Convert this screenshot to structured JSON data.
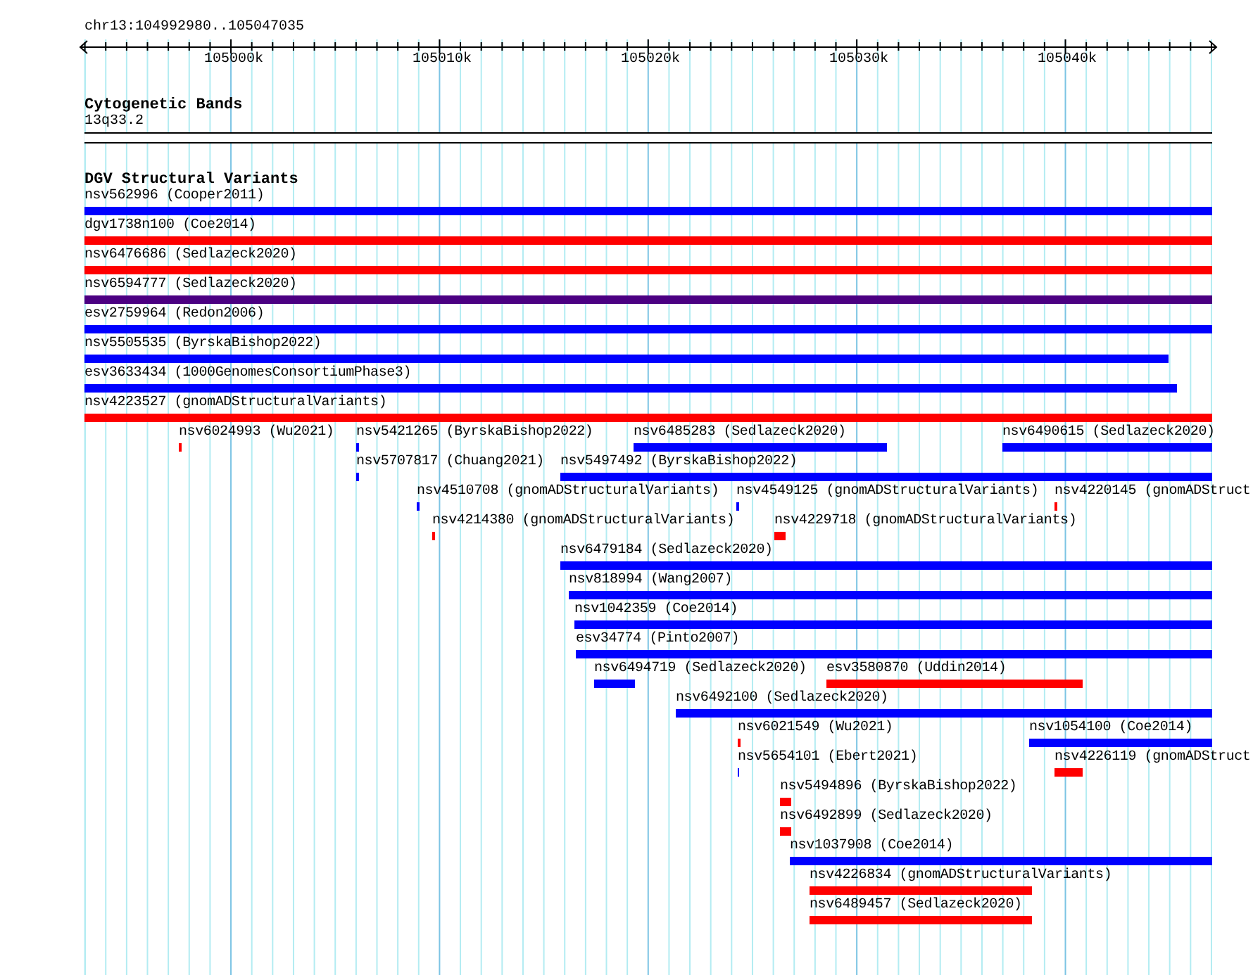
{
  "ruler": {
    "location": "chr13:104992980..105047035",
    "ticks": [
      {
        "label": "105000k"
      },
      {
        "label": "105010k"
      },
      {
        "label": "105020k"
      },
      {
        "label": "105030k"
      },
      {
        "label": "105040k"
      }
    ]
  },
  "tracks": [
    {
      "title": "Cytogenetic Bands",
      "kind": "bands",
      "bands": [
        {
          "label": "13q33.2"
        }
      ]
    },
    {
      "title": "DGV Structural Variants",
      "kind": "variants",
      "rows": [
        {
          "features": [
            {
              "label": "nsv562996 (Cooper2011)",
              "color": "#0000ff"
            }
          ]
        },
        {
          "features": [
            {
              "label": "dgv1738n100 (Coe2014)",
              "color": "#ff0000"
            }
          ]
        },
        {
          "features": [
            {
              "label": "nsv6476686 (Sedlazeck2020)",
              "color": "#ff0000"
            }
          ]
        },
        {
          "features": [
            {
              "label": "nsv6594777 (Sedlazeck2020)",
              "color": "#4b0082"
            }
          ]
        },
        {
          "features": [
            {
              "label": "esv2759964 (Redon2006)",
              "color": "#0000ff"
            }
          ]
        },
        {
          "features": [
            {
              "label": "nsv5505535 (ByrskaBishop2022)",
              "color": "#0000ff"
            }
          ]
        },
        {
          "features": [
            {
              "label": "esv3633434 (1000GenomesConsortiumPhase3)",
              "color": "#0000ff"
            }
          ]
        },
        {
          "features": [
            {
              "label": "nsv4223527 (gnomADStructuralVariants)",
              "color": "#ff0000"
            }
          ]
        },
        {
          "features": [
            {
              "label": "nsv6024993 (Wu2021)",
              "color": "#ff0000"
            },
            {
              "label": "nsv5421265 (ByrskaBishop2022)",
              "color": "#0000ff"
            },
            {
              "label": "nsv6485283 (Sedlazeck2020)",
              "color": "#0000ff"
            },
            {
              "label": "nsv6490615 (Sedlazeck2020)",
              "color": "#0000ff"
            }
          ]
        },
        {
          "features": [
            {
              "label": "nsv5707817 (Chuang2021)",
              "color": "#0000ff"
            },
            {
              "label": "nsv5497492 (ByrskaBishop2022)",
              "color": "#0000ff"
            }
          ]
        },
        {
          "features": [
            {
              "label": "nsv4510708 (gnomADStructuralVariants)",
              "color": "#0000ff"
            },
            {
              "label": "nsv4549125 (gnomADStructuralVariants)",
              "color": "#0000ff"
            },
            {
              "label": "nsv4220145 (gnomADStruct",
              "color": "#ff0000"
            }
          ]
        },
        {
          "features": [
            {
              "label": "nsv4214380 (gnomADStructuralVariants)",
              "color": "#ff0000"
            },
            {
              "label": "nsv4229718 (gnomADStructuralVariants)",
              "color": "#ff0000"
            }
          ]
        },
        {
          "features": [
            {
              "label": "nsv6479184 (Sedlazeck2020)",
              "color": "#0000ff"
            }
          ]
        },
        {
          "features": [
            {
              "label": "nsv818994 (Wang2007)",
              "color": "#0000ff"
            }
          ]
        },
        {
          "features": [
            {
              "label": "nsv1042359 (Coe2014)",
              "color": "#0000ff"
            }
          ]
        },
        {
          "features": [
            {
              "label": "esv34774 (Pinto2007)",
              "color": "#0000ff"
            }
          ]
        },
        {
          "features": [
            {
              "label": "nsv6494719 (Sedlazeck2020)",
              "color": "#0000ff"
            },
            {
              "label": "esv3580870 (Uddin2014)",
              "color": "#ff0000"
            }
          ]
        },
        {
          "features": [
            {
              "label": "nsv6492100 (Sedlazeck2020)",
              "color": "#0000ff"
            }
          ]
        },
        {
          "features": [
            {
              "label": "nsv6021549 (Wu2021)",
              "color": "#ff0000"
            },
            {
              "label": "nsv1054100 (Coe2014)",
              "color": "#0000ff"
            }
          ]
        },
        {
          "features": [
            {
              "label": "nsv5654101 (Ebert2021)",
              "color": "#0000ff"
            },
            {
              "label": "nsv4226119 (gnomADStruct",
              "color": "#ff0000"
            }
          ]
        },
        {
          "features": [
            {
              "label": "nsv5494896 (ByrskaBishop2022)",
              "color": "#ff0000"
            }
          ]
        },
        {
          "features": [
            {
              "label": "nsv6492899 (Sedlazeck2020)",
              "color": "#ff0000"
            }
          ]
        },
        {
          "features": [
            {
              "label": "nsv1037908 (Coe2014)",
              "color": "#0000ff"
            }
          ]
        },
        {
          "features": [
            {
              "label": "nsv4226834 (gnomADStructuralVariants)",
              "color": "#ff0000"
            }
          ]
        },
        {
          "features": [
            {
              "label": "nsv6489457 (Sedlazeck2020)",
              "color": "#ff0000"
            }
          ]
        }
      ]
    }
  ]
}
